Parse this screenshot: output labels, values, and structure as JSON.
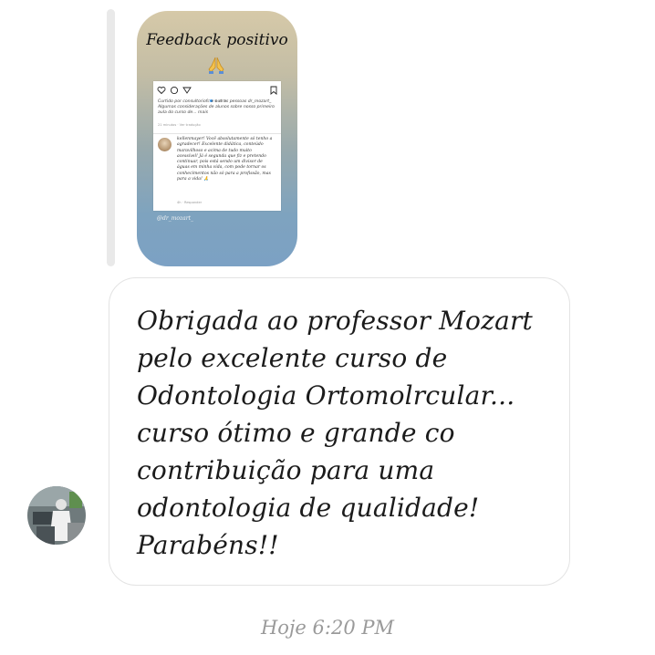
{
  "story": {
    "title": "Feedback positivo",
    "title_icon": "praying-hands-icon",
    "post": {
      "caption": "Curtido por consultoriofc e outras pessoas dr_mozart_ Algumas considerações de alunos sobre nosso primeiro aula do curso de... mais",
      "time": "21 minutos · Ver tradução",
      "comment": "kellenmayer! Você absolutamente só tenho a agradecer! Excelente didática, conteúdo maravilhoso e acima de tudo muito acessível! Já é segunda que fiz e pretendo continuar, pois está sendo um divisor de águas em minha vida, com pode tornar os conhecimentos não só para a profissão, mas para a vida! 🙏",
      "comment_meta": "4h · Responder"
    },
    "handle": "@dr_mozart_"
  },
  "message": {
    "text": "Obrigada ao professor Mozart pelo excelente curso de Odontologia Ortomolrcular... curso ótimo e grande co contribuição para uma odontologia de qualidade! Parabéns!!"
  },
  "timestamp": "Hoje 6:20 PM",
  "colors": {
    "bubble_border": "#e3e3e3",
    "timestamp": "#9a9a9a",
    "text": "#1b1b1b"
  }
}
